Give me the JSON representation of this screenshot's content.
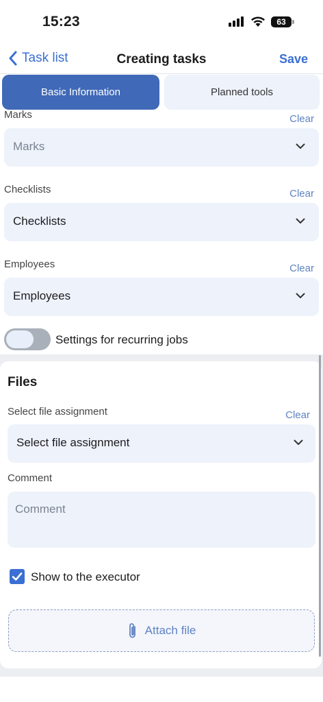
{
  "status_bar": {
    "time": "15:23",
    "battery": "63"
  },
  "nav": {
    "back_label": "Task list",
    "title": "Creating tasks",
    "save_label": "Save"
  },
  "tabs": [
    {
      "label": "Basic Information",
      "active": true
    },
    {
      "label": "Planned tools",
      "active": false
    }
  ],
  "fields": {
    "marks": {
      "label": "Marks",
      "clear": "Clear",
      "placeholder": "Marks"
    },
    "checklists": {
      "label": "Checklists",
      "clear": "Clear",
      "value": "Checklists"
    },
    "employees": {
      "label": "Employees",
      "clear": "Clear",
      "value": "Employees"
    }
  },
  "recurring": {
    "label": "Settings for recurring jobs",
    "enabled": false
  },
  "files": {
    "title": "Files",
    "assignment_label": "Select file assignment",
    "clear": "Clear",
    "assignment_value": "Select file assignment",
    "comment_label": "Comment",
    "comment_placeholder": "Comment",
    "show_to_executor_label": "Show to the executor",
    "show_to_executor_checked": true,
    "attach_label": "Attach file"
  },
  "colors": {
    "accent": "#3a6fd3",
    "tab_active": "#4069b7",
    "field_bg": "#eef2fb",
    "clear_link": "#5f82c2"
  },
  "icons": [
    "back-chevron-icon",
    "chevron-down-icon",
    "paperclip-icon",
    "checkmark-icon",
    "wifi-icon",
    "signal-icon",
    "battery-icon"
  ]
}
